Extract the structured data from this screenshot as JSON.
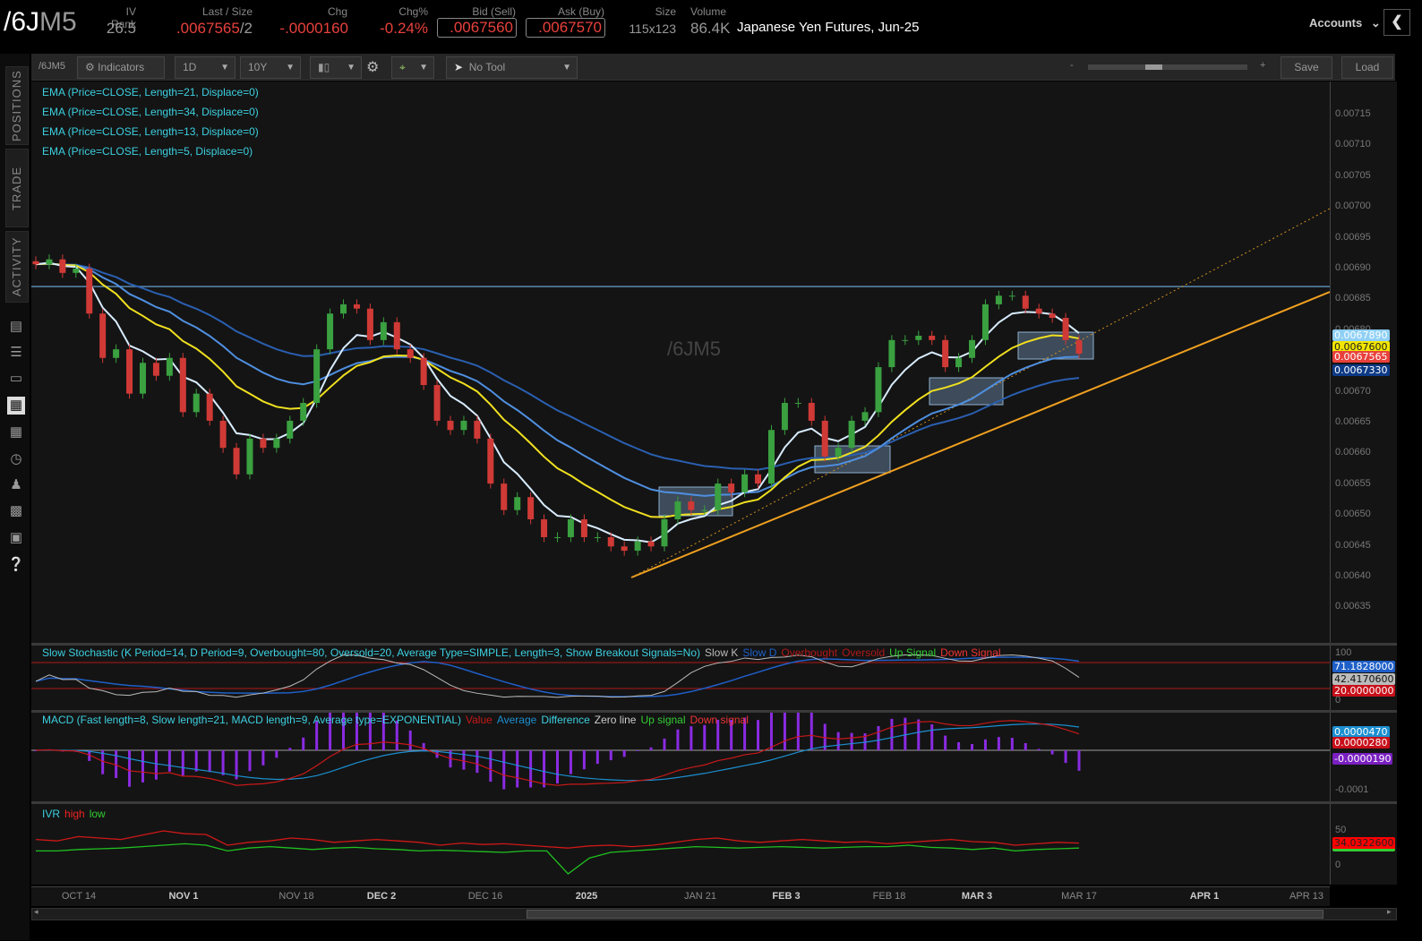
{
  "header": {
    "symbol_a": "/6J",
    "symbol_b": "M5",
    "iv_rank_label": "IV Rank",
    "iv_rank": "26.5",
    "last_label": "Last / Size",
    "last": ".0067565",
    "last_size": "/2",
    "chg_label": "Chg",
    "chg": "-.0000160",
    "chgpct_label": "Chg%",
    "chgpct": "-0.24%",
    "bid_label": "Bid (Sell)",
    "bid": ".0067560",
    "ask_label": "Ask (Buy)",
    "ask": ".0067570",
    "size_label": "Size",
    "size": "115x123",
    "volume_label": "Volume",
    "volume": "86.4K",
    "description": "Japanese Yen Futures, Jun-25",
    "accounts": "Accounts"
  },
  "toolbar": {
    "symbol": "/6JM5",
    "indicators": "Indicators",
    "aggregation": "1D",
    "timeframe": "10Y",
    "tool": "No Tool",
    "zoom_minus": "-",
    "zoom_plus": "+",
    "save": "Save",
    "load": "Load"
  },
  "sidebar": {
    "tabs": [
      "POSITIONS",
      "TRADE",
      "ACTIVITY"
    ]
  },
  "studies": [
    "EMA (Price=CLOSE, Length=21, Displace=0)",
    "EMA (Price=CLOSE, Length=34, Displace=0)",
    "EMA (Price=CLOSE, Length=13, Displace=0)",
    "EMA (Price=CLOSE, Length=5, Displace=0)"
  ],
  "watermark": "/6JM5",
  "price_axis": [
    "0.00715",
    "0.00710",
    "0.00705",
    "0.00700",
    "0.00695",
    "0.00690",
    "0.00685",
    "0.00680",
    "0.00675",
    "0.00670",
    "0.00665",
    "0.00660",
    "0.00655",
    "0.00650",
    "0.00645",
    "0.00640",
    "0.00635"
  ],
  "price_labels": [
    {
      "v": "0.0067890",
      "bg": "#8fd0f5",
      "fg": "#fff"
    },
    {
      "v": "0.0067600",
      "bg": "#f2e600",
      "fg": "#222"
    },
    {
      "v": "0.0067565",
      "bg": "#e8413c",
      "fg": "#fff"
    },
    {
      "v": "0.0067330",
      "bg": "#0d3a86",
      "fg": "#fff"
    }
  ],
  "colors": {
    "up": "#3aa040",
    "down": "#d03a36",
    "ema5": "#d8ecff",
    "ema13": "#f0e020",
    "ema21": "#4f8fe0",
    "ema34": "#2a5fb0"
  },
  "chart_data": {
    "type": "candlestick",
    "closes": [
      0.006907,
      0.006915,
      0.006893,
      0.0069,
      0.006827,
      0.006755,
      0.006769,
      0.006697,
      0.006747,
      0.006726,
      0.006755,
      0.006667,
      0.006697,
      0.006653,
      0.006609,
      0.006566,
      0.006624,
      0.006609,
      0.006624,
      0.006653,
      0.006682,
      0.006769,
      0.006827,
      0.006842,
      0.006835,
      0.006784,
      0.006813,
      0.006769,
      0.006755,
      0.006711,
      0.006653,
      0.006638,
      0.006653,
      0.006624,
      0.006551,
      0.006508,
      0.006529,
      0.006493,
      0.006464,
      0.006464,
      0.006493,
      0.006464,
      0.006464,
      0.006449,
      0.006442,
      0.006457,
      0.006449,
      0.006493,
      0.006522,
      0.006508,
      0.006508,
      0.006551,
      0.006537,
      0.006566,
      0.006551,
      0.006638,
      0.006682,
      0.006682,
      0.006653,
      0.006595,
      0.006609,
      0.006653,
      0.006667,
      0.00674,
      0.006784,
      0.006784,
      0.006791,
      0.006784,
      0.00674,
      0.006755,
      0.006784,
      0.006842,
      0.006856,
      0.006856,
      0.006835,
      0.006827,
      0.00682,
      0.006784,
      0.006762
    ],
    "ylim": [
      0.00632,
      0.00718
    ],
    "ema_lengths": [
      5,
      13,
      21,
      34
    ],
    "resistance": 0.006871
  },
  "stoch": {
    "legend": "Slow Stochastic (K Period=14, D Period=9, Overbought=80, Oversold=20, Average Type=SIMPLE, Length=3, Show Breakout Signals=No)",
    "items": [
      "Slow K",
      "Slow D",
      "Overbought",
      "Oversold",
      "Up Signal",
      "Down Signal"
    ],
    "axis": [
      "100",
      "0"
    ],
    "labels": [
      {
        "v": "71.1828000",
        "bg": "#1f5fc8",
        "fg": "#fff"
      },
      {
        "v": "42.4170600",
        "bg": "#bbb",
        "fg": "#111"
      },
      {
        "v": "20.0000000",
        "bg": "#c8101a",
        "fg": "#fff"
      }
    ]
  },
  "macd": {
    "legend": "MACD (Fast length=8, Slow length=21, MACD length=9, Average type=EXPONENTIAL)",
    "items": [
      "Value",
      "Average",
      "Difference",
      "Zero line",
      "Up signal",
      "Down signal"
    ],
    "axis": [
      "-0.0001"
    ],
    "labels": [
      {
        "v": "0.0000470",
        "bg": "#1b8fd0",
        "fg": "#fff"
      },
      {
        "v": "0.0000280",
        "bg": "#c8101a",
        "fg": "#fff"
      },
      {
        "v": "-0.0000190",
        "bg": "#7a1fc0",
        "fg": "#fff"
      }
    ]
  },
  "ivr": {
    "legend": "IVR",
    "items": [
      "high",
      "low"
    ],
    "axis": [
      "50",
      "0"
    ],
    "labels": [
      {
        "v": "34.0322600",
        "bg": "#f00",
        "fg": "#222"
      }
    ],
    "high": [
      38,
      36,
      42,
      40,
      38,
      44,
      50,
      46,
      45,
      30,
      34,
      36,
      40,
      38,
      34,
      36,
      38,
      36,
      34,
      30,
      33,
      31,
      32,
      30,
      28,
      26,
      29,
      30,
      28,
      30,
      34,
      38,
      40,
      36,
      34,
      36,
      38,
      36,
      34,
      35,
      32,
      34,
      36,
      38,
      35,
      34,
      30,
      32,
      34,
      33
    ],
    "low": [
      22,
      22,
      24,
      25,
      26,
      28,
      30,
      32,
      30,
      22,
      26,
      28,
      26,
      24,
      26,
      27,
      25,
      24,
      22,
      23,
      22,
      21,
      20,
      22,
      22,
      -10,
      12,
      20,
      22,
      24,
      26,
      28,
      27,
      26,
      27,
      28,
      27,
      26,
      27,
      28,
      28,
      30,
      27,
      26,
      24,
      26,
      22,
      24,
      25,
      26
    ]
  },
  "xaxis": [
    {
      "t": "OCT 14",
      "b": false
    },
    {
      "t": "NOV 1",
      "b": true
    },
    {
      "t": "NOV 18",
      "b": false
    },
    {
      "t": "DEC 2",
      "b": true
    },
    {
      "t": "DEC 16",
      "b": false
    },
    {
      "t": "2025",
      "b": true
    },
    {
      "t": "JAN 21",
      "b": false
    },
    {
      "t": "FEB 3",
      "b": true
    },
    {
      "t": "FEB 18",
      "b": false
    },
    {
      "t": "MAR 3",
      "b": true
    },
    {
      "t": "MAR 17",
      "b": false
    },
    {
      "t": "APR 1",
      "b": true
    },
    {
      "t": "APR 13",
      "b": false
    }
  ]
}
